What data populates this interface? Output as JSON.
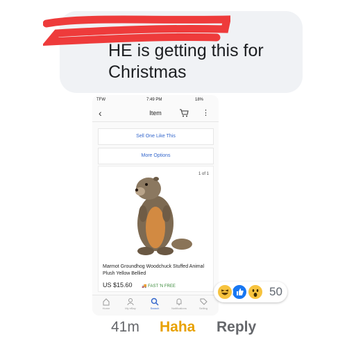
{
  "comment": {
    "line1": "HE is getting this for",
    "line2": "Christmas"
  },
  "screenshot": {
    "status": {
      "carrier": "TFW",
      "time": "7:49 PM",
      "battery": "18%"
    },
    "nav": {
      "title": "Item"
    },
    "buttons": {
      "sell_one": "Sell One Like This",
      "more_options": "More Options"
    },
    "image_counter": "1 of 1",
    "item": {
      "title": "Marmot Groundhog Woodchuck Stuffed Animal Plush Yellow Bellied",
      "price": "US $15.60",
      "shipping": "FAST 'N FREE"
    },
    "tabs": [
      {
        "label": "Home",
        "icon": "home-icon"
      },
      {
        "label": "My eBay",
        "icon": "user-icon"
      },
      {
        "label": "Search",
        "icon": "search-icon"
      },
      {
        "label": "Notifications",
        "icon": "bell-icon"
      },
      {
        "label": "Selling",
        "icon": "tag-icon"
      }
    ],
    "accent_color": "#3366cc"
  },
  "reactions": {
    "types": [
      "haha",
      "like",
      "wow"
    ],
    "count": "50"
  },
  "actions": {
    "time": "41m",
    "reaction": "Haha",
    "reply": "Reply"
  }
}
